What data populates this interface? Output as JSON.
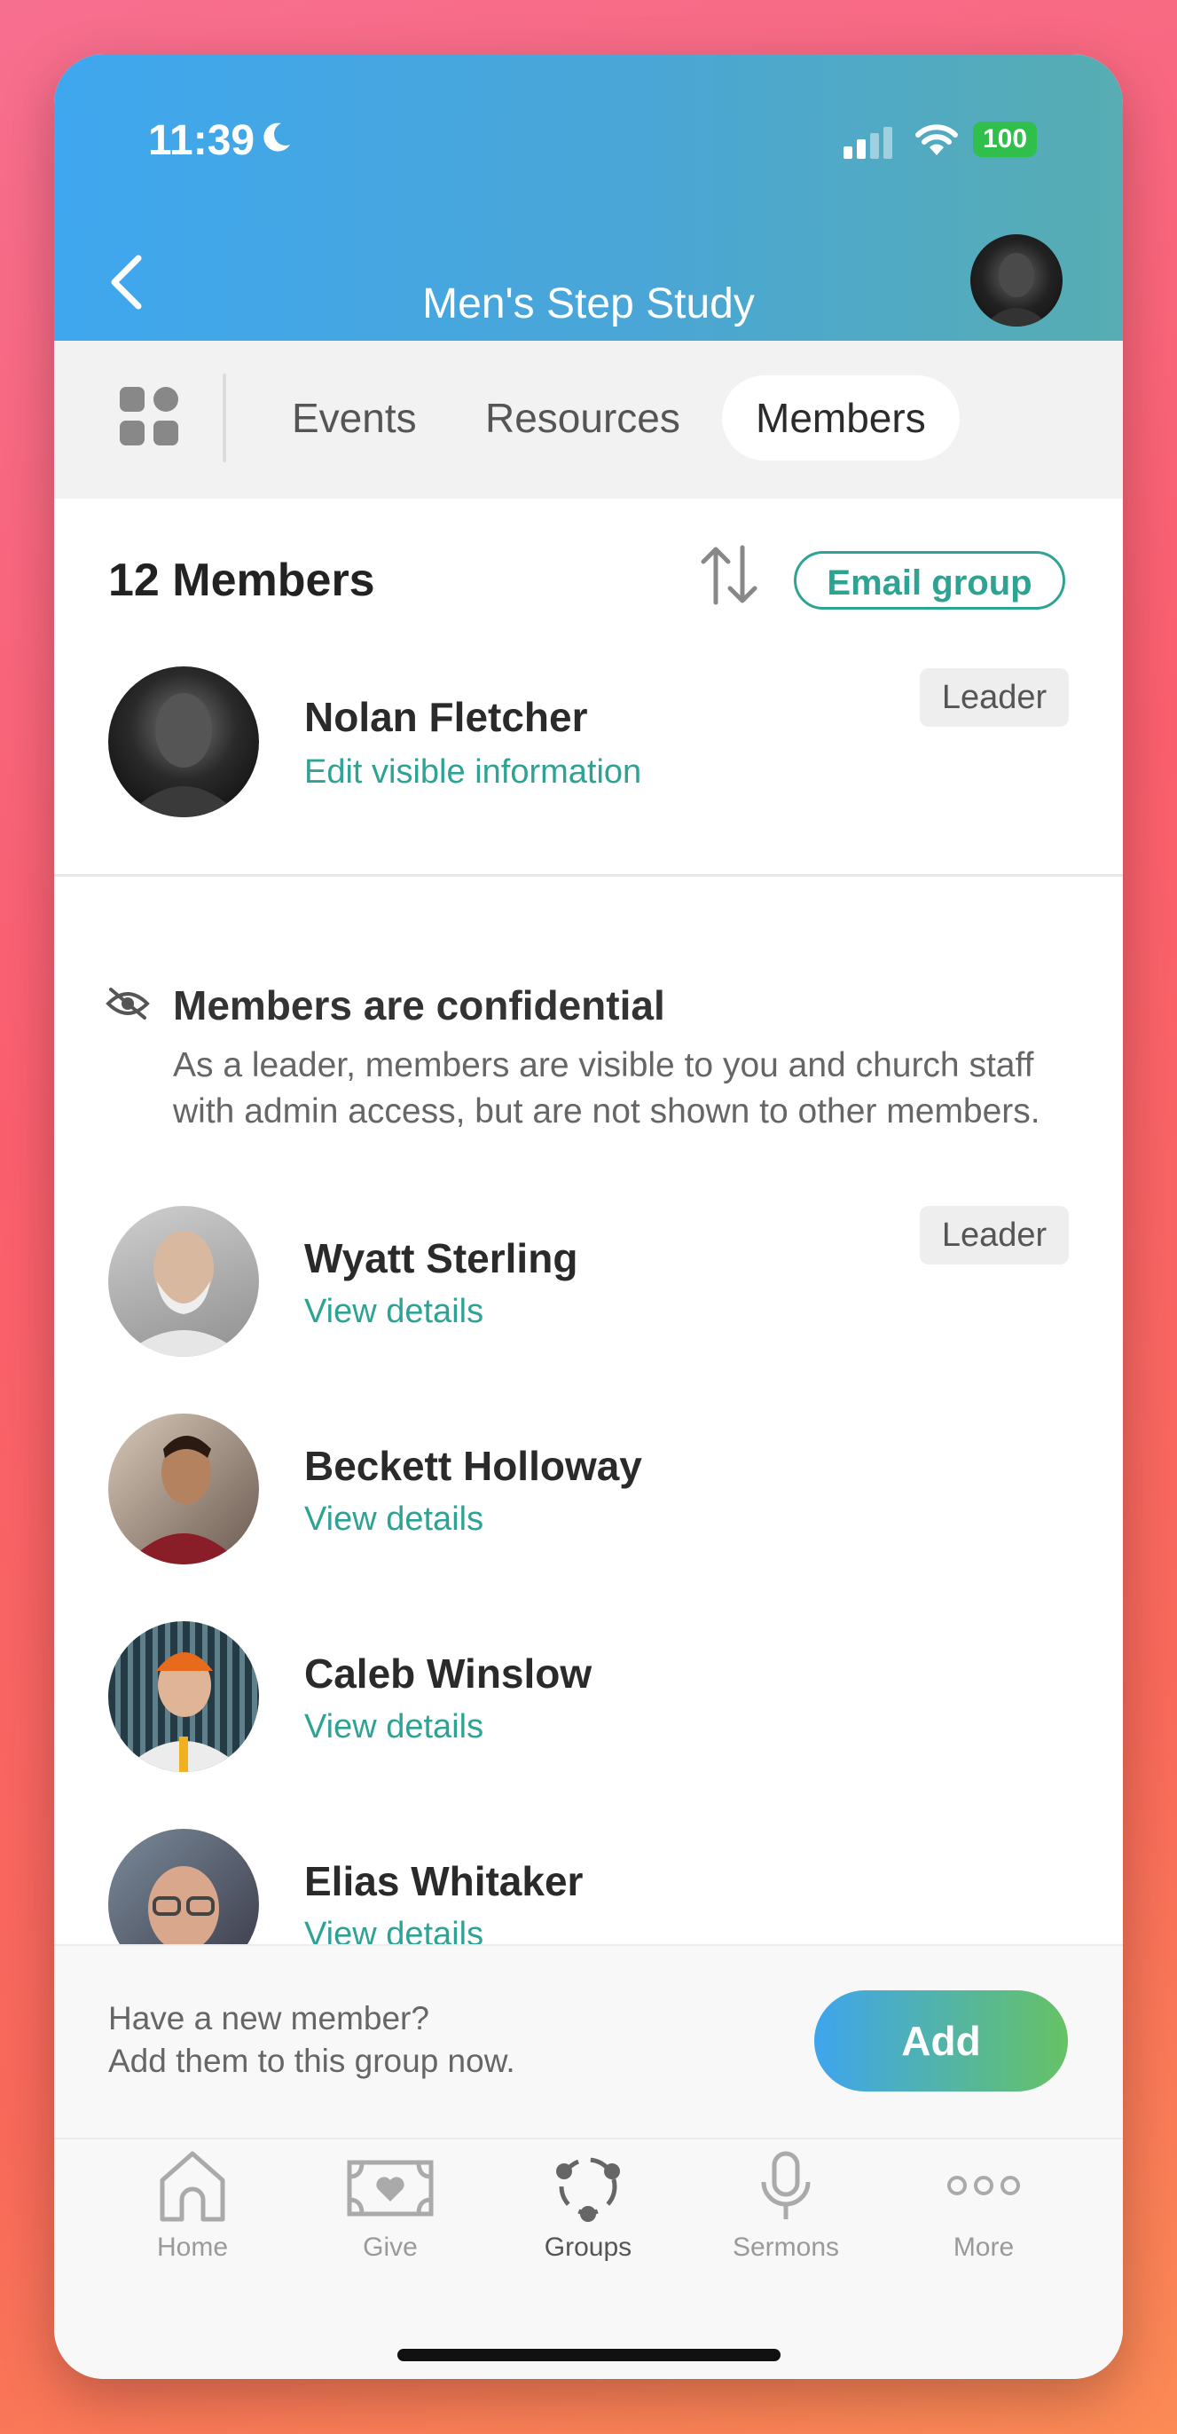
{
  "status_bar": {
    "time": "11:39",
    "battery": "100"
  },
  "header": {
    "title": "Men's Step Study"
  },
  "tabs": [
    {
      "label": "Events"
    },
    {
      "label": "Resources"
    },
    {
      "label": "Members",
      "active": true
    }
  ],
  "members_section": {
    "count_label": "12 Members",
    "email_button": "Email group"
  },
  "current_user": {
    "name": "Nolan Fletcher",
    "action": "Edit visible information",
    "badge": "Leader"
  },
  "confidential_notice": {
    "title": "Members are confidential",
    "body": "As a leader, members are visible to you and church staff with admin access, but are not shown to other members."
  },
  "members": [
    {
      "name": "Wyatt Sterling",
      "action": "View details",
      "badge": "Leader"
    },
    {
      "name": "Beckett Holloway",
      "action": "View details"
    },
    {
      "name": "Caleb Winslow",
      "action": "View details"
    },
    {
      "name": "Elias Whitaker",
      "action": "View details"
    }
  ],
  "add_prompt": {
    "line1": "Have a new member?",
    "line2": "Add them to this group now.",
    "button": "Add"
  },
  "tabbar": [
    {
      "label": "Home",
      "icon": "home-icon"
    },
    {
      "label": "Give",
      "icon": "give-icon"
    },
    {
      "label": "Groups",
      "icon": "groups-icon",
      "active": true
    },
    {
      "label": "Sermons",
      "icon": "microphone-icon"
    },
    {
      "label": "More",
      "icon": "more-icon"
    }
  ],
  "colors": {
    "accent": "#2ea394",
    "header_start": "#3fa7ef",
    "header_end": "#57adb2"
  }
}
